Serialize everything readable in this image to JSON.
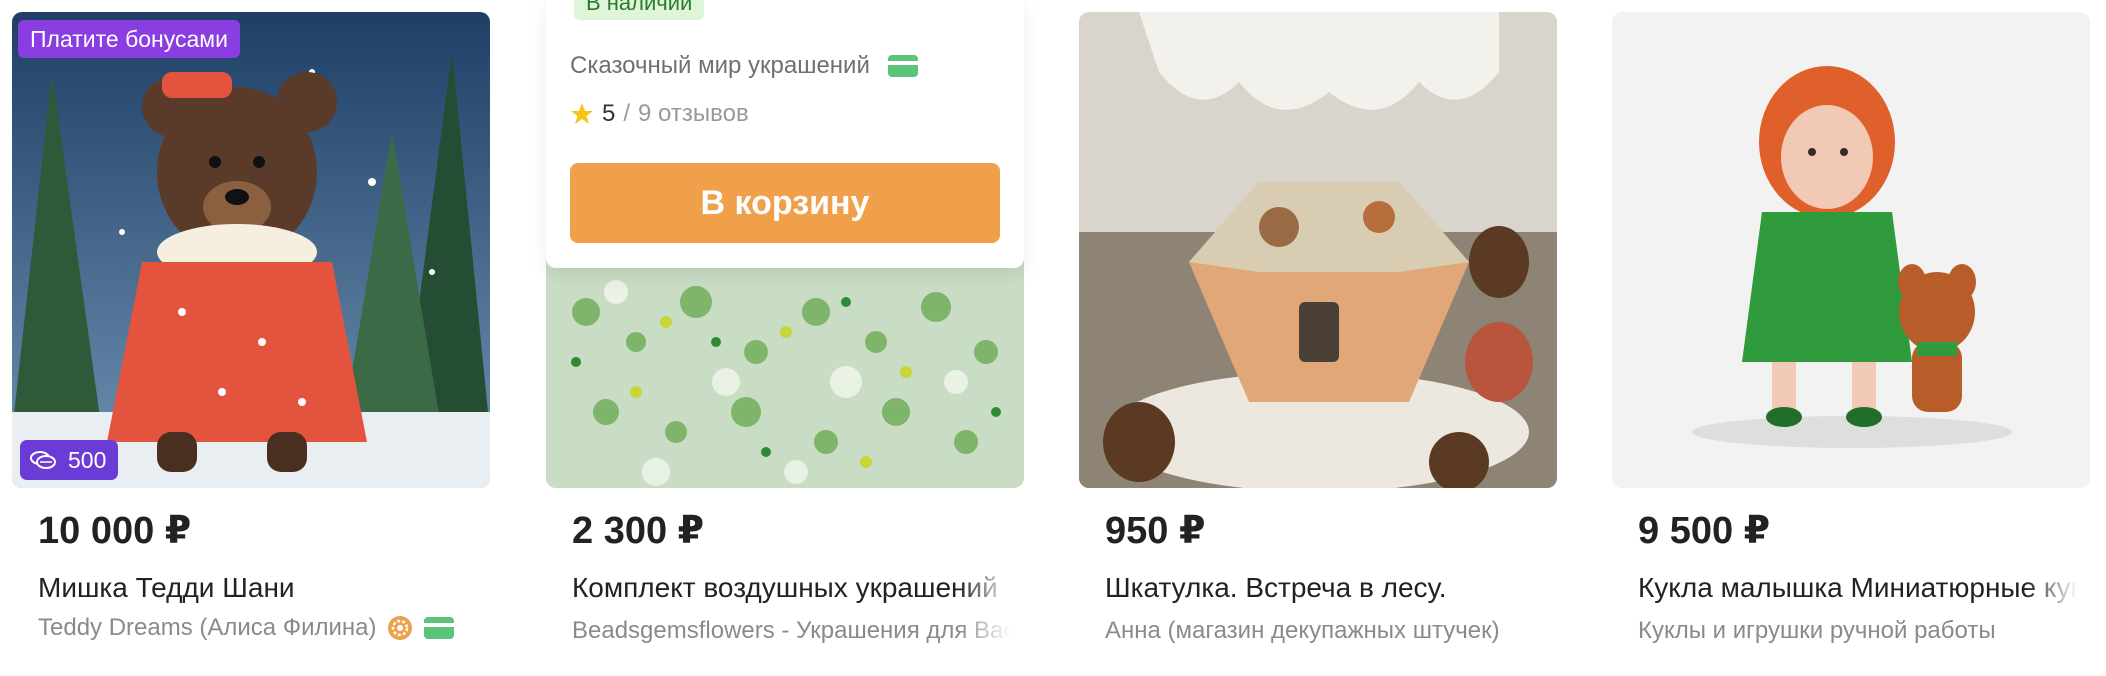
{
  "products": [
    {
      "price": "10 000 ₽",
      "title": "Мишка Тедди Шани",
      "seller": "Teddy Dreams (Алиса Филина)",
      "badge_bonus": "Платите бонусами",
      "badge_points": "500"
    },
    {
      "price": "2 300 ₽",
      "title": "Комплект воздушных украшений",
      "seller": "Beadsgemsflowers - Украшения для Вас",
      "popover": {
        "stock": "В наличии",
        "shop_name": "Сказочный мир украшений",
        "rating": "5",
        "separator": "/",
        "reviews": "9 отзывов",
        "cart_button": "В корзину"
      }
    },
    {
      "price": "950 ₽",
      "title": "Шкатулка. Встреча в лесу.",
      "seller": "Анна (магазин декупажных штучек)"
    },
    {
      "price": "9 500 ₽",
      "title": "Кукла малышка Миниатюрные куклы",
      "seller": "Куклы и игрушки ручной работы"
    }
  ],
  "icons": {
    "card": "card-payment-icon",
    "gear": "master-badge-icon",
    "star": "star-icon",
    "coins": "bonus-coins-icon"
  },
  "colors": {
    "bonus_badge": "#8a3de0",
    "points_badge": "#6b3bd6",
    "cart_button": "#f0a04b",
    "stock_badge_bg": "#dff5d9",
    "card_icon": "#5cc47a",
    "star": "#f5c518"
  }
}
